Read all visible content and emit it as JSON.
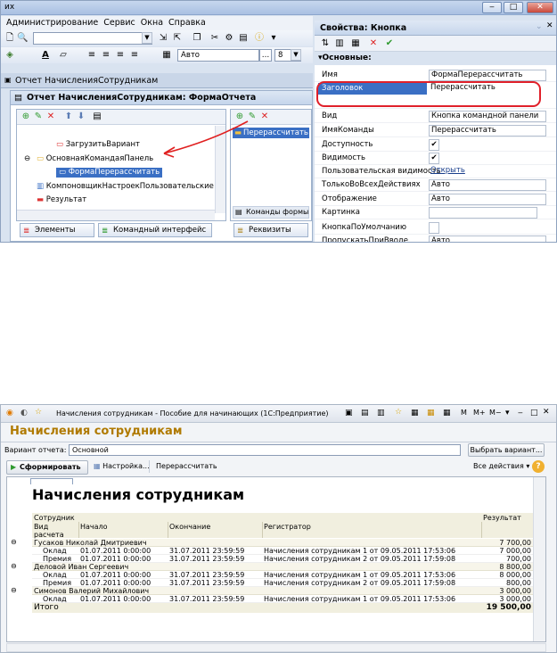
{
  "top": {
    "title_fragment": "их",
    "menu": [
      "Администрирование",
      "Сервис",
      "Окна",
      "Справка"
    ],
    "zoom_value": "Авто",
    "font_size_value": "8",
    "report_tab_label": "Отчет НачисленияСотрудникам",
    "form_title": "Отчет НачисленияСотрудникам: ФормаОтчета",
    "tree": [
      {
        "label": "ЗагрузитьВариант",
        "level": 2,
        "icon": "button-icon"
      },
      {
        "label": "ОсновнаяКомандаяПанель",
        "level": 1,
        "icon": "folder-icon"
      },
      {
        "label": "ФормаПерерассчитать",
        "level": 2,
        "icon": "button-icon",
        "selected": true
      },
      {
        "label": "КомпоновщикНастроекПользовательские",
        "level": 1,
        "icon": "composer-icon"
      },
      {
        "label": "Результат",
        "level": 1,
        "icon": "result-icon"
      }
    ],
    "command_item": "Перерассчитать",
    "command_panel_footer": "Команды формы",
    "tabs_left": [
      "Элементы",
      "Командный интерфейс"
    ],
    "tab_right": "Реквизиты"
  },
  "props": {
    "title": "Свойства: Кнопка",
    "section": "Основные:",
    "rows": [
      {
        "k": "Имя",
        "v": "ФормаПерерассчитать",
        "kind": "text"
      },
      {
        "k": "Заголовок",
        "v": "Перерассчитать",
        "kind": "highlight"
      },
      {
        "k": "Вид",
        "v": "Кнопка командной панели",
        "kind": "select"
      },
      {
        "k": "ИмяКоманды",
        "v": "Перерассчитать",
        "kind": "more"
      },
      {
        "k": "Доступность",
        "v": "✔",
        "kind": "check"
      },
      {
        "k": "Видимость",
        "v": "✔",
        "kind": "check"
      },
      {
        "k": "Пользовательская видимость",
        "v": "Открыть",
        "kind": "link"
      },
      {
        "k": "ТолькоВоВсехДействиях",
        "v": "Авто",
        "kind": "select"
      },
      {
        "k": "Отображение",
        "v": "Авто",
        "kind": "select"
      },
      {
        "k": "Картинка",
        "v": "",
        "kind": "more-x"
      },
      {
        "k": "КнопкаПоУмолчанию",
        "v": "",
        "kind": "checkbox"
      },
      {
        "k": "ПропускатьПриВводе",
        "v": "Авто",
        "kind": "select"
      }
    ]
  },
  "app": {
    "window_title": "Начисления сотрудникам - Пособие для начинающих (1С:Предприятие)",
    "form_header": "Начисления сотрудникам",
    "variant_label": "Вариант отчета:",
    "variant_value": "Основной",
    "choose_variant": "Выбрать вариант...",
    "generate_button": "Сформировать",
    "settings_button": "Настройка...",
    "recalc_button": "Перерассчитать",
    "all_actions": "Все действия",
    "help": "?"
  },
  "report": {
    "title": "Начисления сотрудникам",
    "headers": {
      "employee": "Сотрудник",
      "type": "Вид расчета",
      "start": "Начало",
      "end": "Окончание",
      "registrar": "Регистратор",
      "result": "Результат"
    },
    "groups": [
      {
        "name": "Гусаков Николай Дмитриевич",
        "total": "7 700,00",
        "rows": [
          {
            "type": "Оклад",
            "start": "01.07.2011 0:00:00",
            "end": "31.07.2011 23:59:59",
            "reg": "Начисления сотрудникам 1 от 09.05.2011 17:53:06",
            "res": "7 000,00"
          },
          {
            "type": "Премия",
            "start": "01.07.2011 0:00:00",
            "end": "31.07.2011 23:59:59",
            "reg": "Начисления сотрудникам 2 от 09.05.2011 17:59:08",
            "res": "700,00"
          }
        ]
      },
      {
        "name": "Деловой Иван Сергеевич",
        "total": "8 800,00",
        "rows": [
          {
            "type": "Оклад",
            "start": "01.07.2011 0:00:00",
            "end": "31.07.2011 23:59:59",
            "reg": "Начисления сотрудникам 1 от 09.05.2011 17:53:06",
            "res": "8 000,00"
          },
          {
            "type": "Премия",
            "start": "01.07.2011 0:00:00",
            "end": "31.07.2011 23:59:59",
            "reg": "Начисления сотрудникам 2 от 09.05.2011 17:59:08",
            "res": "800,00"
          }
        ]
      },
      {
        "name": "Симонов Валерий Михайлович",
        "total": "3 000,00",
        "rows": [
          {
            "type": "Оклад",
            "start": "01.07.2011 0:00:00",
            "end": "31.07.2011 23:59:59",
            "reg": "Начисления сотрудникам 1 от 09.05.2011 17:53:06",
            "res": "3 000,00"
          }
        ]
      }
    ],
    "total_label": "Итого",
    "total_value": "19 500,00"
  },
  "colors": {
    "accent": "#c0504d",
    "highlight_row": "#3a6fc4",
    "header_text": "#b07a00"
  }
}
